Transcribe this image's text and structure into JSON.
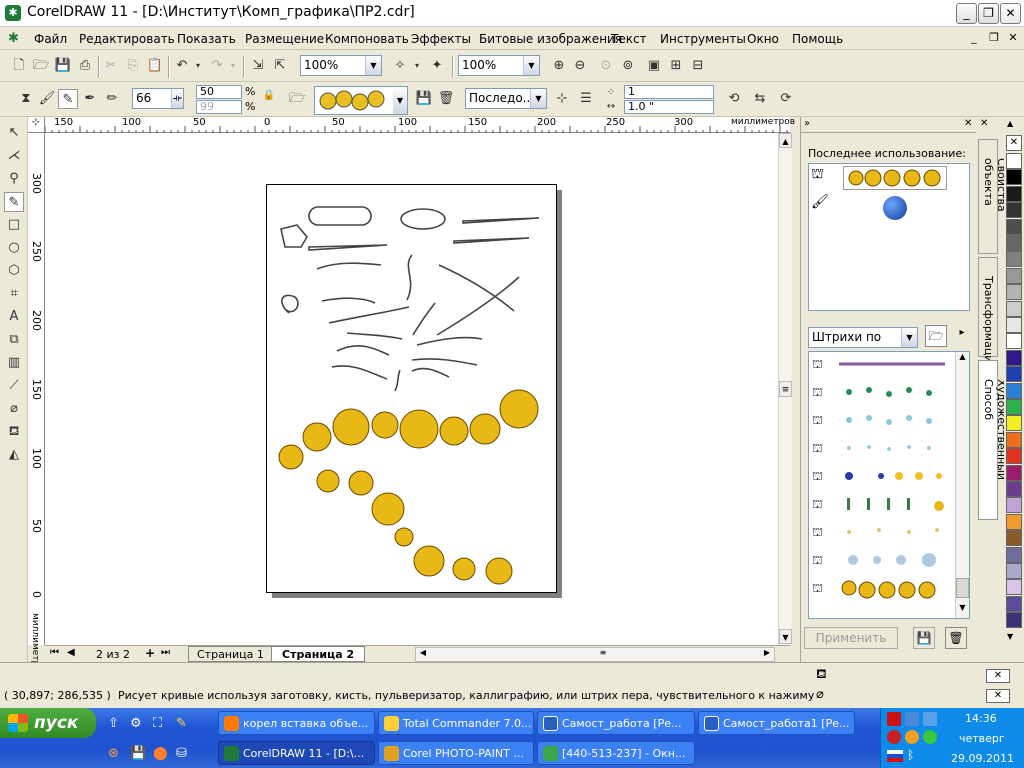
{
  "window": {
    "title": "CorelDRAW 11 - [D:\\Институт\\Комп_графика\\ПР2.cdr]",
    "icon": "coreldraw-app-icon",
    "minimize": "_",
    "restore": "❐",
    "close": "✕"
  },
  "menu": {
    "items": [
      "Файл",
      "Редактировать",
      "Показать",
      "Размещение",
      "Компоновать",
      "Эффекты",
      "Битовые изображения",
      "Текст",
      "Инструменты",
      "Окно",
      "Помощь"
    ],
    "doc_min": "_",
    "doc_restore": "❐",
    "doc_close": "✕"
  },
  "toolbar1": {
    "zoom1": "100%",
    "zoom2": "100%"
  },
  "toolbar2": {
    "brush_size": "66",
    "val50": "50",
    "val99": "99",
    "pct1": "%",
    "pct2": "%",
    "stroke_mode": "Последо...",
    "spacing": "1",
    "spacing2": "1.0 \""
  },
  "ruler": {
    "units": "миллиметров",
    "h_ticks": [
      "150",
      "100",
      "50",
      "0",
      "50",
      "100",
      "150",
      "200",
      "250",
      "300"
    ],
    "v_ticks": [
      "300",
      "250",
      "200",
      "150",
      "100",
      "50",
      "0"
    ],
    "v_units": "миллиметров"
  },
  "pages": {
    "counter": "2 из 2",
    "tab1": "Страница 1",
    "tab2": "Страница 2"
  },
  "docker": {
    "recent_label": "Последнее использование:",
    "dropdown": "Штрихи по умолча",
    "apply_button": "Применить",
    "tabs": [
      "Свойства объекта",
      "Трансформация",
      "Художественный Способ"
    ]
  },
  "status": {
    "coords": "( 30,897; 286,535 )",
    "hint": "Рисует кривые используя заготовку, кисть, пульверизатор, каллиграфию, или штрих пера, чувствительного к нажиму"
  },
  "taskbar": {
    "start": "пуск",
    "tasks_row1": [
      "корел вставка объе...",
      "Total Commander 7.0...",
      "Самост_работа [Ре...",
      "Самост_работа1 [Ре..."
    ],
    "tasks_row2": [
      "CorelDRAW 11 - [D:\\...",
      "Corel PHOTO-PAINT ...",
      "[440-513-237] - Окн..."
    ],
    "time": "14:36",
    "day": "четверг",
    "date": "29.09.2011"
  },
  "palette": [
    "#ffffff",
    "#000000",
    "#1a1a1a",
    "#333333",
    "#4d4d4d",
    "#666666",
    "#808080",
    "#999999",
    "#b3b3b3",
    "#cccccc",
    "#e6e6e6",
    "#ffffff",
    "#2e1a8a",
    "#1f3fb3",
    "#2a80d8",
    "#2bb24a",
    "#f2ef20",
    "#f26d1c",
    "#e0301e",
    "#9b1e6c",
    "#6a3d8f",
    "#c0a4d8",
    "#f29a2e",
    "#8b5a2b",
    "#6e6e9e",
    "#a9a9cc",
    "#d8c4e8",
    "#5c4b9a",
    "#3d3278"
  ]
}
